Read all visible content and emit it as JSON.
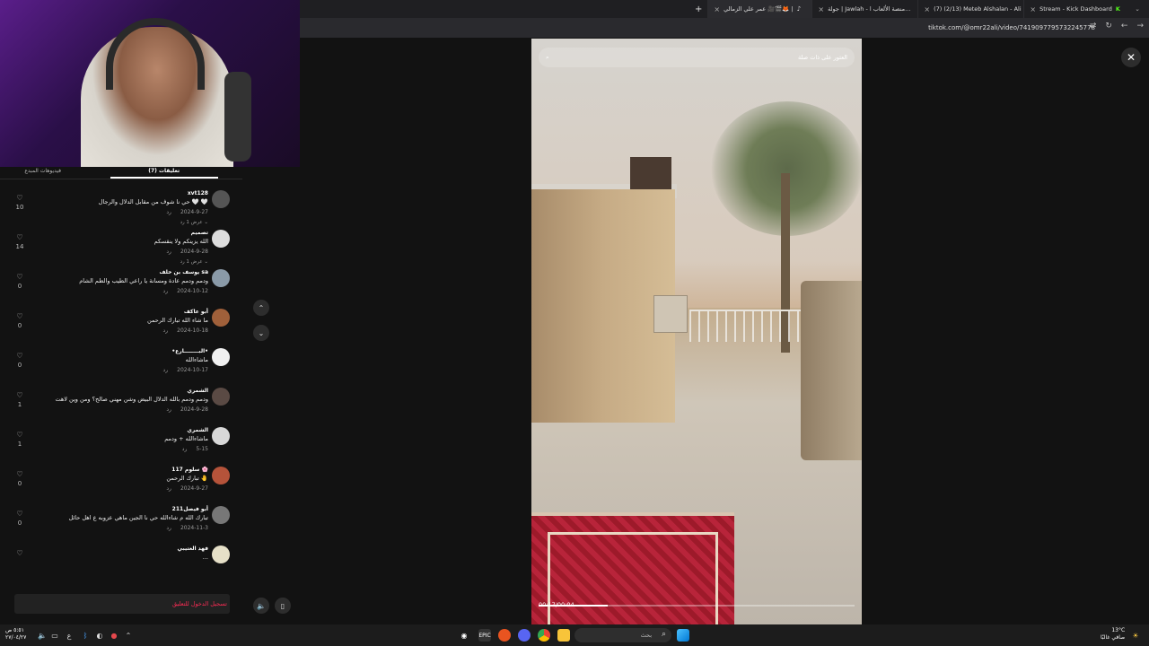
{
  "browser": {
    "tabs": [
      {
        "label": "عمر علي الزمالي 🎥🎬🦊 |"
      },
      {
        "label": "جولة | Jawlah - منصة الألعاب ا..."
      },
      {
        "label": "(7) (2/13) Meteb Alshalan - Ali"
      },
      {
        "label": "Stream - Kick Dashboard"
      }
    ],
    "url": "tiktok.com/@omr22ali/video/7419097795732245778"
  },
  "panel": {
    "tabs": {
      "active": "تعليقات (7)",
      "other": "فيديوهات المبدع"
    },
    "comments": [
      {
        "user": "xvt128",
        "text": "حي نا شوف من مقابل الدلال والرجال 🤍 🤍",
        "date": "2024-9-27",
        "reply": "رد",
        "replies": "عرض 1 رد ⌄",
        "likes": "10"
      },
      {
        "user": "تصميم",
        "text": "الله يزينكم ولا ينقسكم",
        "date": "2024-9-28",
        "reply": "رد",
        "replies": "عرض 1 رد ⌄",
        "likes": "14"
      },
      {
        "user": "يوسف بن خلف sa",
        "text": "ودمم ودمم عادة ومسانة يا راعي الطيب والطم الشام",
        "date": "2024-10-12",
        "reply": "رد",
        "replies": "",
        "likes": "0"
      },
      {
        "user": "أبو عاكف",
        "text": "ما شاء الله تبارك الرحمن",
        "date": "2024-10-18",
        "reply": "رد",
        "replies": "",
        "likes": "0"
      },
      {
        "user": "•البــــــــارع•",
        "text": "ماشاءالله",
        "date": "2024-10-17",
        "reply": "رد",
        "replies": "",
        "likes": "0"
      },
      {
        "user": "الشمري",
        "text": "ودمم ودمم بالله الدلال البيض وشن مهني صالح؟ ومن وين لاهت",
        "date": "2024-9-28",
        "reply": "رد",
        "replies": "",
        "likes": "1"
      },
      {
        "user": "الشمري",
        "text": "ماشاءالله + ودمم",
        "date": "5-15",
        "reply": "رد",
        "replies": "",
        "likes": "1"
      },
      {
        "user": "سلوم 117 🌸",
        "text": "تبارك الرحمن 🤚",
        "date": "2024-9-27",
        "reply": "رد",
        "replies": "",
        "likes": "0"
      },
      {
        "user": "أبو فيصل211",
        "text": "تبارك الله م شاءالله حي نا الجين ماهي عزوبه ع اهل حائل",
        "date": "2024-11-3",
        "reply": "رد",
        "replies": "",
        "likes": "0"
      },
      {
        "user": "فهد العتيبي",
        "text": "...",
        "date": "",
        "reply": "",
        "replies": "",
        "likes": ""
      }
    ],
    "login_prompt": "تسجيل الدخول للتعليق"
  },
  "video": {
    "search_placeholder": "العثور على ذات صلة",
    "time": "00:17/00:04",
    "progress": 0.22
  },
  "taskbar": {
    "search_placeholder": "بحث",
    "clock_time": "٥:٥١ ص",
    "clock_date": "٢٧/٠٤/٢٧",
    "weather_temp": "13°C",
    "weather_text": "صافي غالبًا",
    "lang": "ع"
  },
  "colors": {
    "accent": "#fe2c55",
    "background": "#121212"
  }
}
